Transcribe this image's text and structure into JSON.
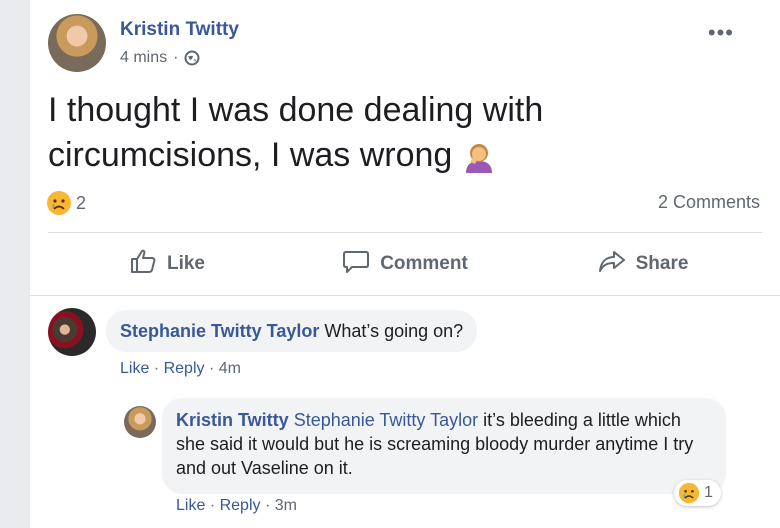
{
  "post": {
    "author": "Kristin Twitty",
    "time": "4 mins",
    "separator": "·",
    "more": "•••",
    "text": "I thought I was done dealing with circumcisions, I was wrong",
    "reaction_count": "2",
    "comments_count": "2 Comments"
  },
  "actions": {
    "like": "Like",
    "comment": "Comment",
    "share": "Share"
  },
  "comments": [
    {
      "author": "Stephanie Twitty Taylor",
      "text": "What’s going on?",
      "like": "Like",
      "reply": "Reply",
      "dot": "·",
      "time": "4m"
    },
    {
      "author": "Kristin Twitty",
      "mention": "Stephanie Twitty Taylor",
      "text": "it’s bleeding a little which she said it would but he is screaming bloody murder anytime I try and out Vaseline on it.",
      "like": "Like",
      "reply": "Reply",
      "dot": "·",
      "time": "3m",
      "reaction_count": "1"
    }
  ],
  "icons": {
    "globe": "globe-icon",
    "sad": "crying-face-emoji",
    "facepalm": "facepalm-emoji",
    "like": "thumbs-up-icon",
    "comment": "speech-bubble-icon",
    "share": "share-arrow-icon"
  },
  "colors": {
    "link": "#385898",
    "muted": "#606770",
    "bubble": "#f2f3f5"
  }
}
